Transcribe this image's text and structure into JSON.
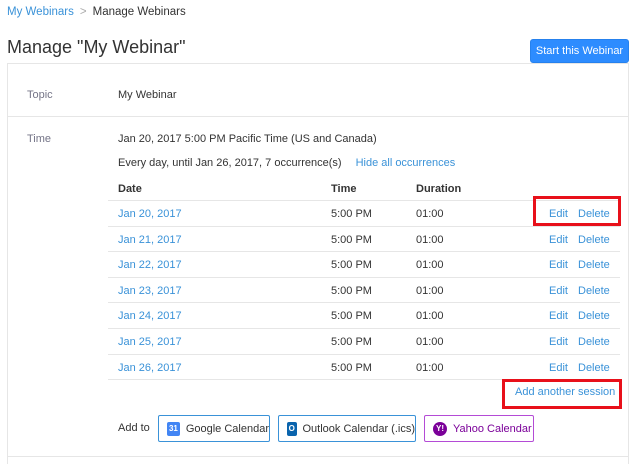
{
  "breadcrumb": {
    "parent": "My Webinars",
    "separator": ">",
    "current": "Manage Webinars"
  },
  "page": {
    "title": "Manage \"My Webinar\"",
    "start_button": "Start this Webinar"
  },
  "topic": {
    "label": "Topic",
    "value": "My Webinar"
  },
  "time": {
    "label": "Time",
    "line1": "Jan 20, 2017 5:00 PM Pacific Time (US and Canada)",
    "line2": "Every day, until Jan 26, 2017, 7 occurrence(s)",
    "hide_link": "Hide all occurrences"
  },
  "occurrences": {
    "headers": {
      "date": "Date",
      "time": "Time",
      "duration": "Duration"
    },
    "edit_label": "Edit",
    "delete_label": "Delete",
    "rows": [
      {
        "date": "Jan 20, 2017",
        "time": "5:00 PM",
        "duration": "01:00"
      },
      {
        "date": "Jan 21, 2017",
        "time": "5:00 PM",
        "duration": "01:00"
      },
      {
        "date": "Jan 22, 2017",
        "time": "5:00 PM",
        "duration": "01:00"
      },
      {
        "date": "Jan 23, 2017",
        "time": "5:00 PM",
        "duration": "01:00"
      },
      {
        "date": "Jan 24, 2017",
        "time": "5:00 PM",
        "duration": "01:00"
      },
      {
        "date": "Jan 25, 2017",
        "time": "5:00 PM",
        "duration": "01:00"
      },
      {
        "date": "Jan 26, 2017",
        "time": "5:00 PM",
        "duration": "01:00"
      }
    ],
    "add_session": "Add another session"
  },
  "add_to": {
    "label": "Add to",
    "google": {
      "label": "Google Calendar",
      "icon": "google-calendar-icon",
      "glyph": "31"
    },
    "outlook": {
      "label": "Outlook Calendar (.ics)",
      "icon": "outlook-icon",
      "glyph": "O"
    },
    "yahoo": {
      "label": "Yahoo Calendar",
      "icon": "yahoo-icon",
      "glyph": "Y!"
    }
  },
  "colors": {
    "accent": "#2d8cff",
    "link": "#3a92d8",
    "highlight": "#e8101a",
    "yahoo": "#7b0099"
  }
}
